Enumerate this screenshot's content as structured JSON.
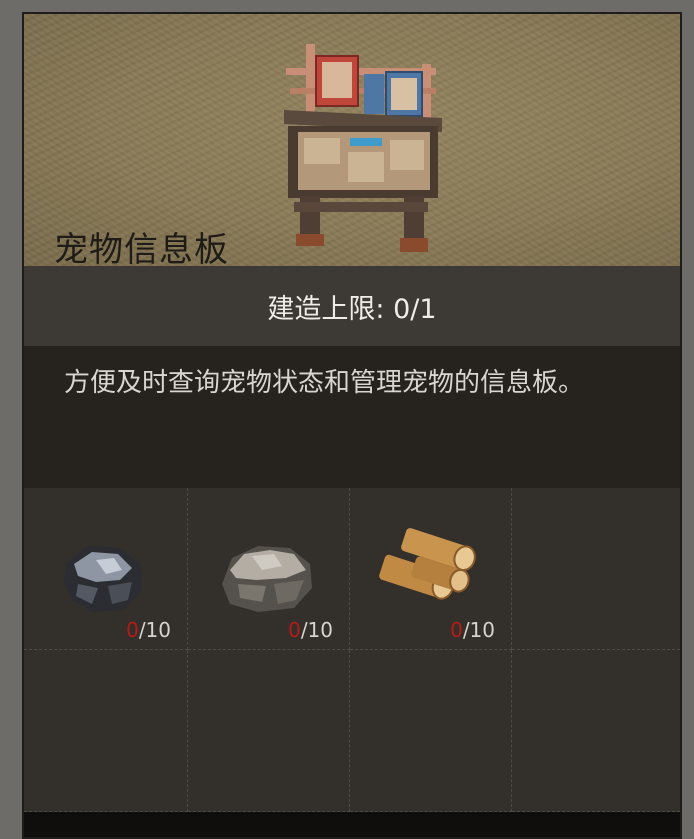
{
  "item": {
    "name": "宠物信息板",
    "icon": "pet-info-board-icon"
  },
  "build_limit": {
    "label": "建造上限",
    "separator": ":",
    "current": "0",
    "max": "1",
    "display": "建造上限: 0/1"
  },
  "description": "方便及时查询宠物状态和管理宠物的信息板。",
  "materials": [
    {
      "icon": "iron-ore-icon",
      "have": "0",
      "need": "/10"
    },
    {
      "icon": "stone-icon",
      "have": "0",
      "need": "/10"
    },
    {
      "icon": "wood-log-icon",
      "have": "0",
      "need": "/10"
    }
  ],
  "colors": {
    "insufficient": "#b71a16",
    "header_bg": "#8b7c58",
    "panel_bg": "#2c2926"
  }
}
